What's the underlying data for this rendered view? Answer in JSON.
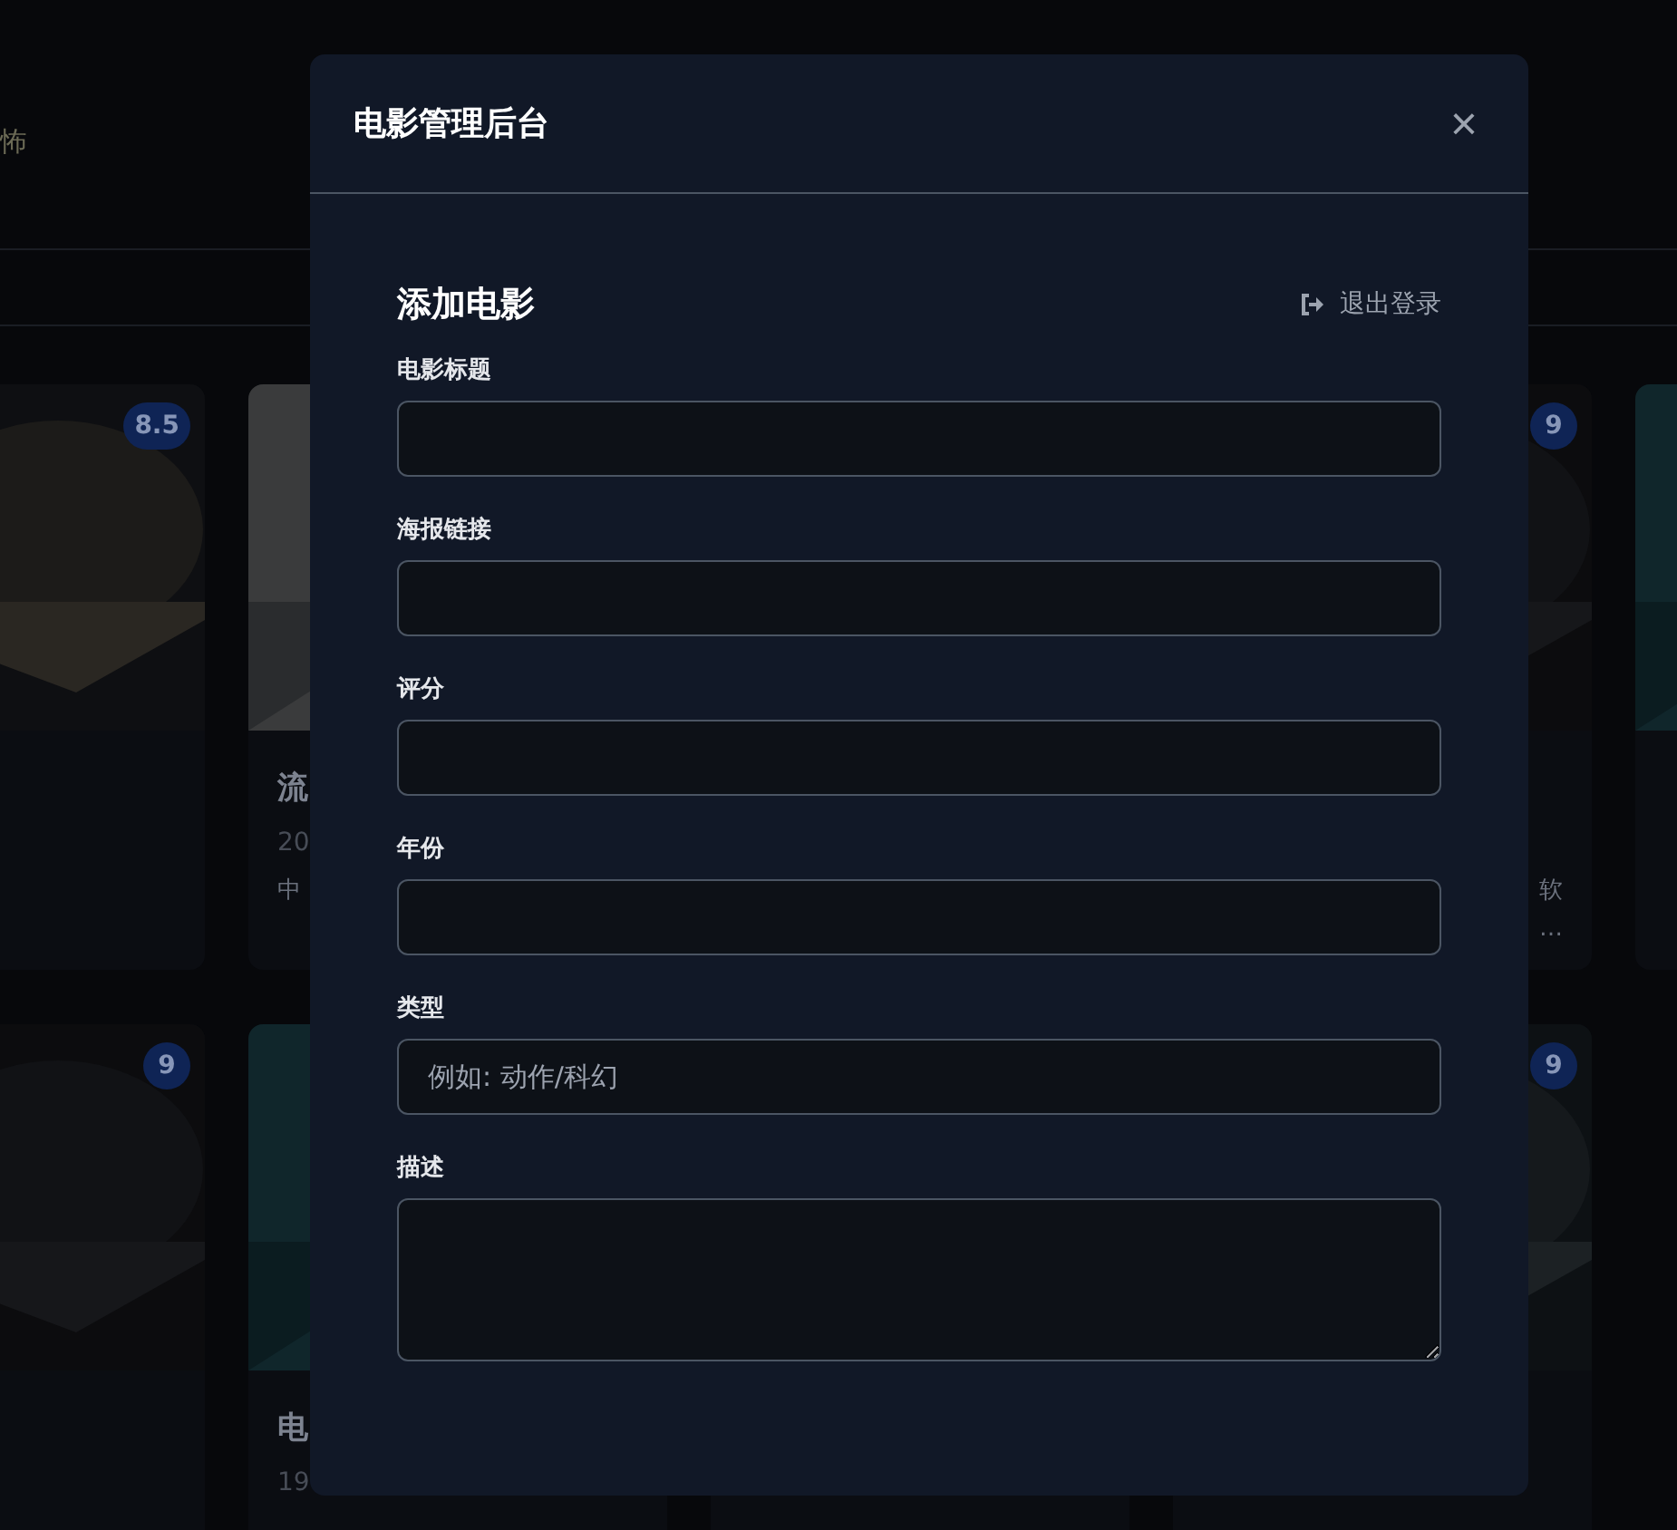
{
  "nav": {
    "genre_tab": "怖"
  },
  "card_rows": [
    {
      "cards": [
        {
          "kind": "card",
          "badge": "8.5"
        },
        {
          "kind": "card",
          "title": "流",
          "year": "20",
          "description": [
            "中"
          ]
        },
        {
          "kind": "hidden"
        },
        {
          "kind": "card_cut_left",
          "badge": "9",
          "description": [
            "软",
            "…"
          ]
        },
        {
          "kind": "card"
        }
      ]
    },
    {
      "cards": [
        {
          "kind": "card",
          "badge": "9"
        },
        {
          "kind": "card",
          "title": "电",
          "year": "19"
        },
        {
          "kind": "covered"
        },
        {
          "kind": "card_cut_left",
          "badge": "9"
        }
      ]
    }
  ],
  "modal": {
    "title": "电影管理后台",
    "close": "×",
    "form": {
      "heading": "添加电影",
      "logout": "退出登录",
      "fields": [
        {
          "label": "电影标题",
          "kind": "input"
        },
        {
          "label": "海报链接",
          "kind": "input"
        },
        {
          "label": "评分",
          "kind": "input"
        },
        {
          "label": "年份",
          "kind": "input"
        },
        {
          "label": "类型",
          "kind": "input",
          "placeholder": "例如: 动作/科幻"
        },
        {
          "label": "描述",
          "kind": "textarea"
        }
      ]
    }
  }
}
